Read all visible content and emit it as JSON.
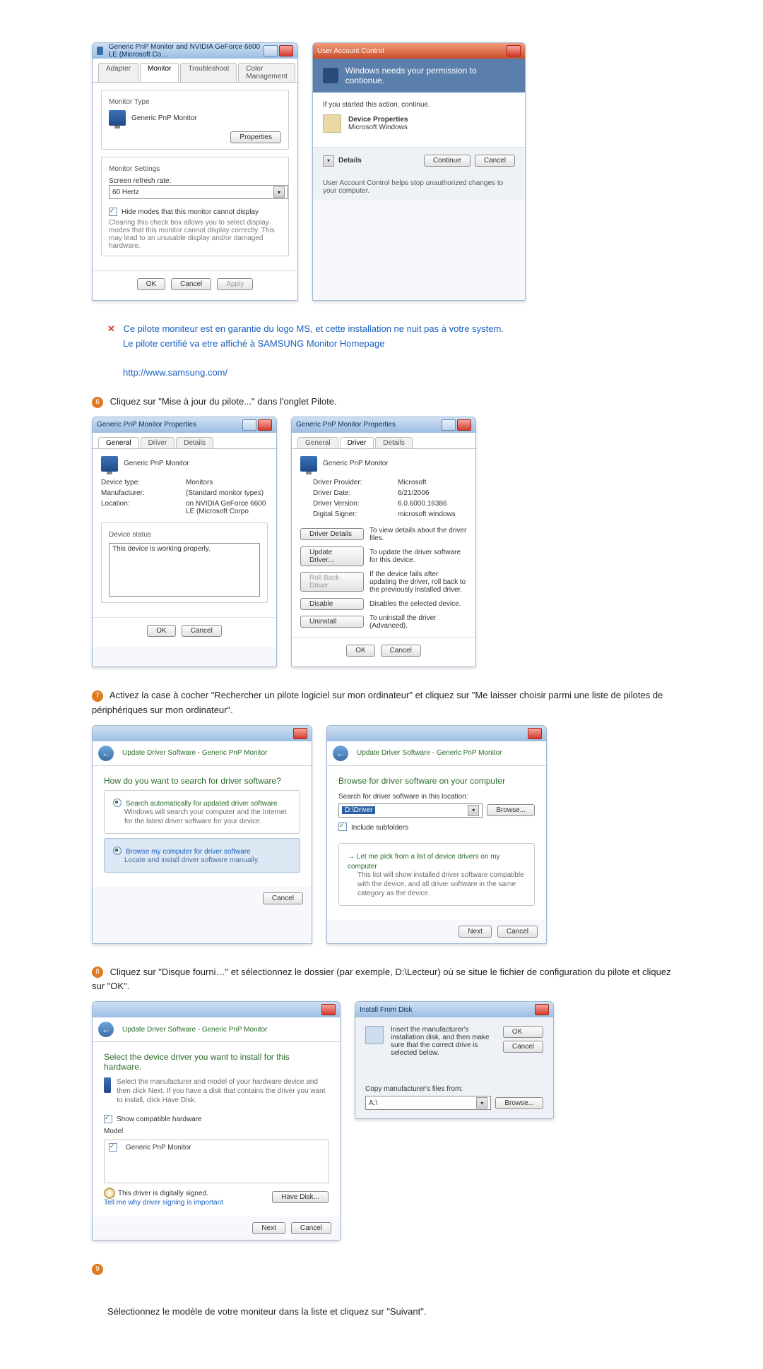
{
  "img1": {
    "title": "Generic PnP Monitor and NVIDIA GeForce 6600 LE (Microsoft Co…",
    "tabs": [
      "Adapter",
      "Monitor",
      "Troubleshoot",
      "Color Management"
    ],
    "monitor_type_label": "Monitor Type",
    "monitor_type_value": "Generic PnP Monitor",
    "properties_btn": "Properties",
    "settings_label": "Monitor Settings",
    "refresh_label": "Screen refresh rate:",
    "refresh_value": "60 Hertz",
    "hide_modes": "Hide modes that this monitor cannot display",
    "hide_desc": "Clearing this check box allows you to select display modes that this monitor cannot display correctly. This may lead to an unusable display and/or damaged hardware.",
    "ok": "OK",
    "cancel": "Cancel",
    "apply": "Apply"
  },
  "uac": {
    "title": "User Account Control",
    "head": "Windows needs your permission to contionue.",
    "started": "If you started this action, continue.",
    "prog_name": "Device Properties",
    "prog_pub": "Microsoft Windows",
    "details": "Details",
    "continue": "Continue",
    "cancel": "Cancel",
    "foot": "User Account Control helps stop unauthorized changes to your computer."
  },
  "textA": {
    "line1": "Ce pilote moniteur est en garantie du logo MS, et cette installation ne nuit pas à votre system.",
    "line2": "Le pilote certifié va etre affiché à SAMSUNG Monitor Homepage",
    "url": "http://www.samsung.com/"
  },
  "step6": {
    "num": "6",
    "text": "Cliquez sur \"Mise à jour du pilote...\" dans l'onglet Pilote."
  },
  "props_general": {
    "title": "Generic PnP Monitor Properties",
    "tabs": [
      "General",
      "Driver",
      "Details"
    ],
    "name": "Generic PnP Monitor",
    "labels": {
      "type": "Device type:",
      "mfr": "Manufacturer:",
      "loc": "Location:"
    },
    "values": {
      "type": "Monitors",
      "mfr": "(Standard monitor types)",
      "loc": "on NVIDIA GeForce 6600 LE (Microsoft Corpo"
    },
    "status_label": "Device status",
    "status_value": "This device is working properly.",
    "ok": "OK",
    "cancel": "Cancel"
  },
  "props_driver": {
    "title": "Generic PnP Monitor Properties",
    "tabs": [
      "General",
      "Driver",
      "Details"
    ],
    "name": "Generic PnP Monitor",
    "kv": {
      "provider_l": "Driver Provider:",
      "provider_v": "Microsoft",
      "date_l": "Driver Date:",
      "date_v": "6/21/2006",
      "ver_l": "Driver Version:",
      "ver_v": "6.0.6000.16386",
      "sign_l": "Digital Signer:",
      "sign_v": "microsoft windows"
    },
    "btns": {
      "details": "Driver Details",
      "details_d": "To view details about the driver files.",
      "update": "Update Driver...",
      "update_d": "To update the driver software for this device.",
      "rollback": "Roll Back Driver",
      "rollback_d": "If the device fails after updating the driver, roll back to the previously installed driver.",
      "disable": "Disable",
      "disable_d": "Disables the selected device.",
      "uninstall": "Uninstall",
      "uninstall_d": "To uninstall the driver (Advanced)."
    },
    "ok": "OK",
    "cancel": "Cancel"
  },
  "step7": {
    "num": "7",
    "text": "Activez la case à cocher \"Rechercher un pilote logiciel sur mon ordinateur\" et cliquez sur \"Me laisser choisir parmi une liste de pilotes de périphériques sur mon ordinateur\"."
  },
  "updateA": {
    "crumb": "Update Driver Software - Generic PnP Monitor",
    "q": "How do you want to search for driver software?",
    "opt1_t": "Search automatically for updated driver software",
    "opt1_d": "Windows will search your computer and the Internet for the latest driver software for your device.",
    "opt2_t": "Browse my computer for driver software",
    "opt2_d": "Locate and install driver software manually.",
    "cancel": "Cancel"
  },
  "updateB": {
    "crumb": "Update Driver Software - Generic PnP Monitor",
    "head": "Browse for driver software on your computer",
    "loc_label": "Search for driver software in this location:",
    "loc_value": "D:\\Driver",
    "browse": "Browse...",
    "include": "Include subfolders",
    "pick_t": "Let me pick from a list of device drivers on my computer",
    "pick_d": "This list will show installed driver software compatible with the device, and all driver software in the same category as the device.",
    "next": "Next",
    "cancel": "Cancel"
  },
  "step8": {
    "num": "8",
    "text": "Cliquez sur \"Disque fourni…\" et sélectionnez le dossier (par exemple, D:\\Lecteur) où se situe le fichier de configuration du pilote et cliquez sur \"OK\"."
  },
  "updateC": {
    "crumb": "Update Driver Software - Generic PnP Monitor",
    "head": "Select the device driver you want to install for this hardware.",
    "sub": "Select the manufacturer and model of your hardware device and then click Next. If you have a disk that contains the driver you want to install, click Have Disk.",
    "show_compat": "Show compatible hardware",
    "model_label": "Model",
    "model_value": "Generic PnP Monitor",
    "signed": "This driver is digitally signed.",
    "tell": "Tell me why driver signing is important",
    "have_disk": "Have Disk...",
    "next": "Next",
    "cancel": "Cancel"
  },
  "install_disk": {
    "title": "Install From Disk",
    "msg": "Insert the manufacturer's installation disk, and then make sure that the correct drive is selected below.",
    "ok": "OK",
    "cancel": "Cancel",
    "copy_label": "Copy manufacturer's files from:",
    "value": "A:\\",
    "browse": "Browse..."
  },
  "step9": {
    "num": "9"
  },
  "step9_text": "Sélectionnez le modèle de votre moniteur dans la liste et cliquez sur \"Suivant\"."
}
